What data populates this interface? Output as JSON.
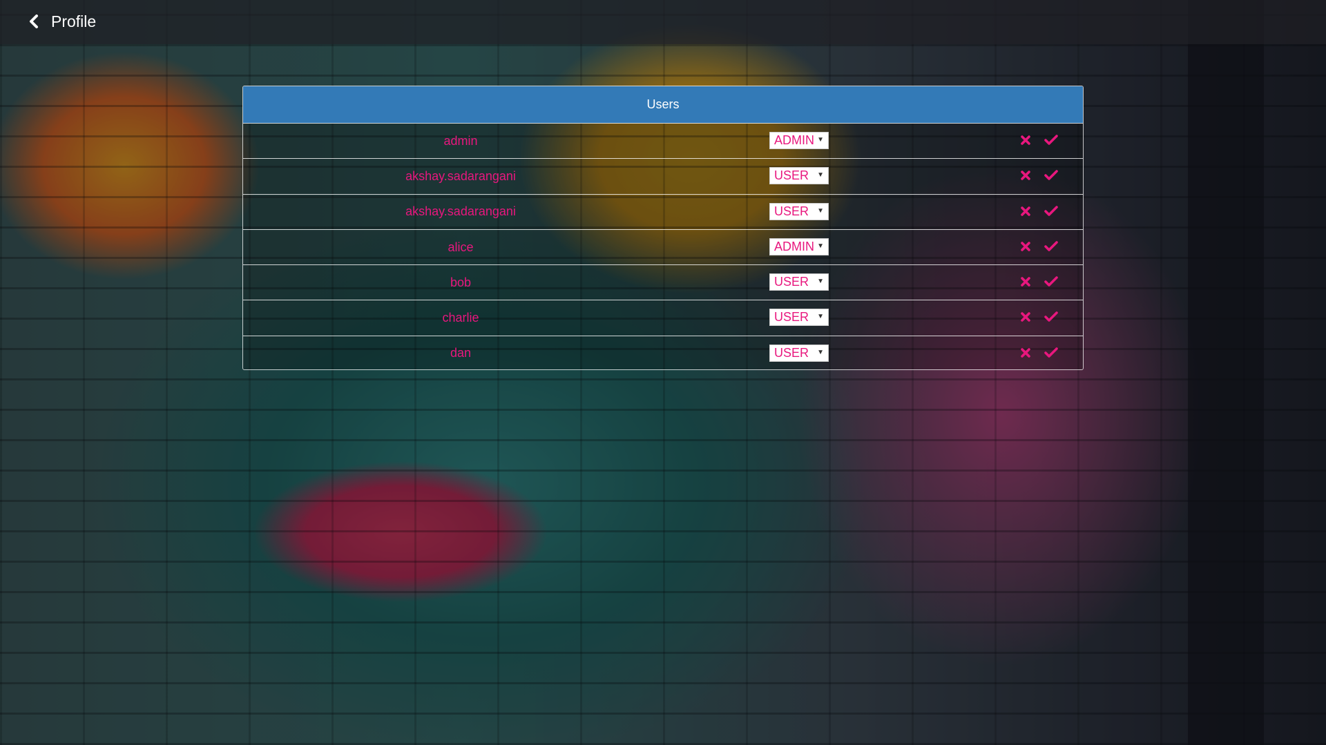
{
  "header": {
    "title": "Profile"
  },
  "panel": {
    "title": "Users"
  },
  "users": [
    {
      "name": "admin",
      "role": "ADMIN"
    },
    {
      "name": "akshay.sadarangani",
      "role": "USER"
    },
    {
      "name": "akshay.sadarangani",
      "role": "USER"
    },
    {
      "name": "alice",
      "role": "ADMIN"
    },
    {
      "name": "bob",
      "role": "USER"
    },
    {
      "name": "charlie",
      "role": "USER"
    },
    {
      "name": "dan",
      "role": "USER"
    }
  ],
  "colors": {
    "header_blue": "#337ab7",
    "accent_pink": "#e8177e"
  },
  "icons": {
    "back": "chevron-left-icon",
    "remove": "close-icon",
    "confirm": "check-icon",
    "dropdown": "caret-down-icon"
  }
}
